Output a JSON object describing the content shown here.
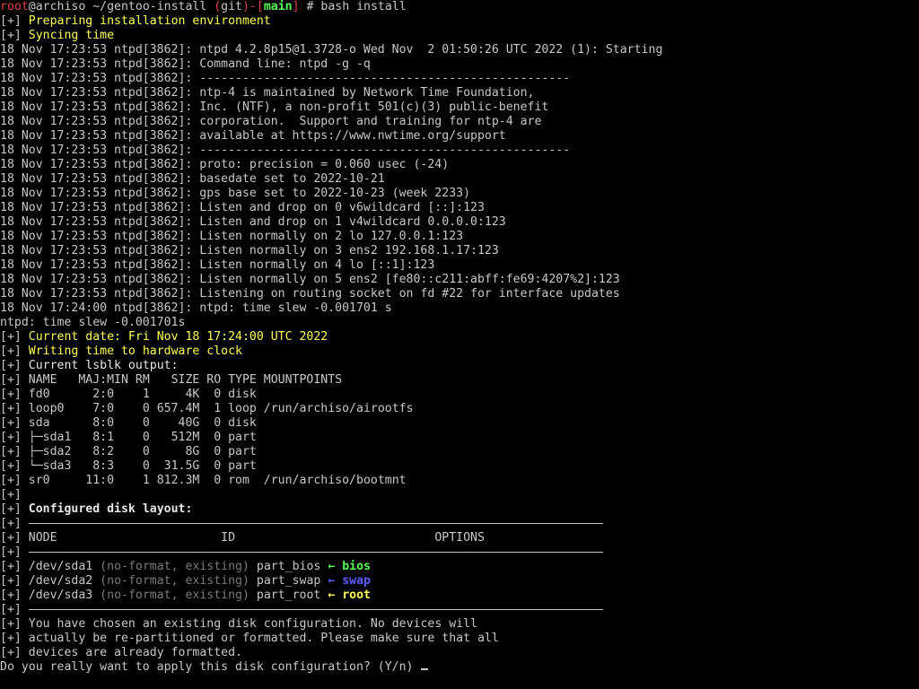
{
  "prompt": {
    "user": "root",
    "at": "@",
    "host": "archiso",
    "path": " ~/gentoo-install ",
    "git_open": "(",
    "git_label": "git",
    "git_close": ")",
    "branch_dash": "-",
    "branch_open": "[",
    "branch": "main",
    "branch_close": "]",
    "symbol": " # ",
    "command": "bash install"
  },
  "bracket": "[+]",
  "status_preparing": "Preparing installation environment",
  "status_syncing": "Syncing time",
  "ntpd_lines": [
    "18 Nov 17:23:53 ntpd[3862]: ntpd 4.2.8p15@1.3728-o Wed Nov  2 01:50:26 UTC 2022 (1): Starting",
    "18 Nov 17:23:53 ntpd[3862]: Command line: ntpd -g -q",
    "18 Nov 17:23:53 ntpd[3862]: ----------------------------------------------------",
    "18 Nov 17:23:53 ntpd[3862]: ntp-4 is maintained by Network Time Foundation,",
    "18 Nov 17:23:53 ntpd[3862]: Inc. (NTF), a non-profit 501(c)(3) public-benefit",
    "18 Nov 17:23:53 ntpd[3862]: corporation.  Support and training for ntp-4 are",
    "18 Nov 17:23:53 ntpd[3862]: available at https://www.nwtime.org/support",
    "18 Nov 17:23:53 ntpd[3862]: ----------------------------------------------------",
    "18 Nov 17:23:53 ntpd[3862]: proto: precision = 0.060 usec (-24)",
    "18 Nov 17:23:53 ntpd[3862]: basedate set to 2022-10-21",
    "18 Nov 17:23:53 ntpd[3862]: gps base set to 2022-10-23 (week 2233)",
    "18 Nov 17:23:53 ntpd[3862]: Listen and drop on 0 v6wildcard [::]:123",
    "18 Nov 17:23:53 ntpd[3862]: Listen and drop on 1 v4wildcard 0.0.0.0:123",
    "18 Nov 17:23:53 ntpd[3862]: Listen normally on 2 lo 127.0.0.1:123",
    "18 Nov 17:23:53 ntpd[3862]: Listen normally on 3 ens2 192.168.1.17:123",
    "18 Nov 17:23:53 ntpd[3862]: Listen normally on 4 lo [::1]:123",
    "18 Nov 17:23:53 ntpd[3862]: Listen normally on 5 ens2 [fe80::c211:abff:fe69:4207%2]:123",
    "18 Nov 17:23:53 ntpd[3862]: Listening on routing socket on fd #22 for interface updates",
    "18 Nov 17:24:00 ntpd[3862]: ntpd: time slew -0.001701 s"
  ],
  "time_slew": "ntpd: time slew -0.001701s",
  "status_current_date": "Current date: Fri Nov 18 17:24:00 UTC 2022",
  "status_writing_clock": "Writing time to hardware clock",
  "status_lsblk": "Current lsblk output:",
  "lsblk_rows": [
    "NAME   MAJ:MIN RM   SIZE RO TYPE MOUNTPOINTS",
    "fd0      2:0    1     4K  0 disk",
    "loop0    7:0    0 657.4M  1 loop /run/archiso/airootfs",
    "sda      8:0    0    40G  0 disk",
    "├─sda1   8:1    0   512M  0 part",
    "├─sda2   8:2    0     8G  0 part",
    "└─sda3   8:3    0  31.5G  0 part",
    "sr0     11:0    1 812.3M  0 rom  /run/archiso/bootmnt"
  ],
  "status_disk_layout": "Configured disk layout:",
  "layout_header": "NODE                       ID                            OPTIONS",
  "layout_rows": [
    {
      "node": "/dev/sda1",
      "info": "(no-format, existing)",
      "id": "part_bios",
      "arrow": "←",
      "tag": "bios",
      "color": "green"
    },
    {
      "node": "/dev/sda2",
      "info": "(no-format, existing)",
      "id": "part_swap",
      "arrow": "←",
      "tag": "swap",
      "color": "blue"
    },
    {
      "node": "/dev/sda3",
      "info": "(no-format, existing)",
      "id": "part_root",
      "arrow": "←",
      "tag": "root",
      "color": "yellow"
    }
  ],
  "warning_lines": [
    "You have chosen an existing disk configuration. No devices will",
    "actually be re-partitioned or formatted. Please make sure that all",
    "devices are already formatted."
  ],
  "confirm_prompt": "Do you really want to apply this disk configuration? (Y/n) "
}
